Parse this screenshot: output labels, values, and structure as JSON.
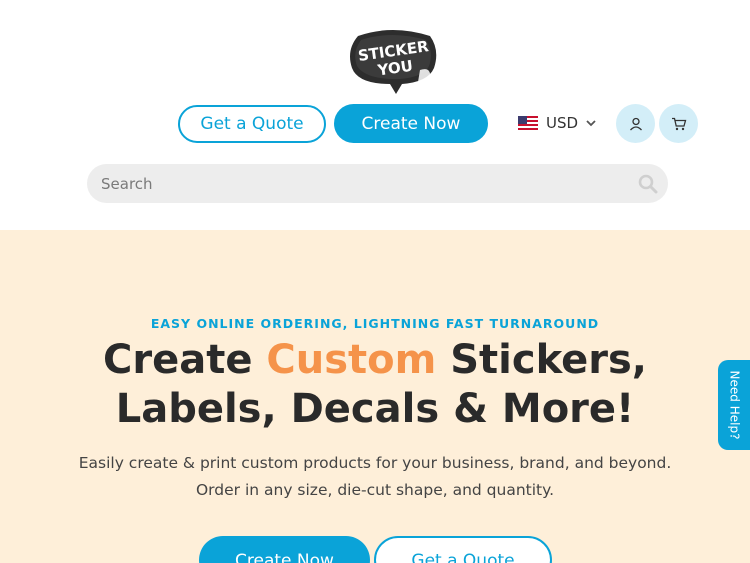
{
  "header": {
    "logo_text_line1": "STICKER",
    "logo_text_line2": "YOU",
    "get_quote_label": "Get a Quote",
    "create_now_label": "Create Now",
    "currency": {
      "code": "USD",
      "flag_icon": "us-flag-icon"
    },
    "account_icon": "user-icon",
    "cart_icon": "cart-icon",
    "search": {
      "placeholder": "Search",
      "value": "",
      "icon": "search-icon"
    }
  },
  "hero": {
    "eyebrow": "EASY ONLINE ORDERING, LIGHTNING FAST TURNAROUND",
    "headline_before": "Create ",
    "headline_accent": "Custom",
    "headline_after": " Stickers, Labels, Decals & More!",
    "subtext": "Easily create & print custom products for your business, brand, and beyond. Order in any size, die-cut shape, and quantity.",
    "create_now_label": "Create Now",
    "get_quote_label": "Get a Quote"
  },
  "help_tab": {
    "label": "Need Help?"
  },
  "colors": {
    "brand_blue": "#0aa3d8",
    "accent_orange": "#f5934a",
    "hero_background": "#feefd9",
    "icon_circle": "#d3eef8"
  }
}
